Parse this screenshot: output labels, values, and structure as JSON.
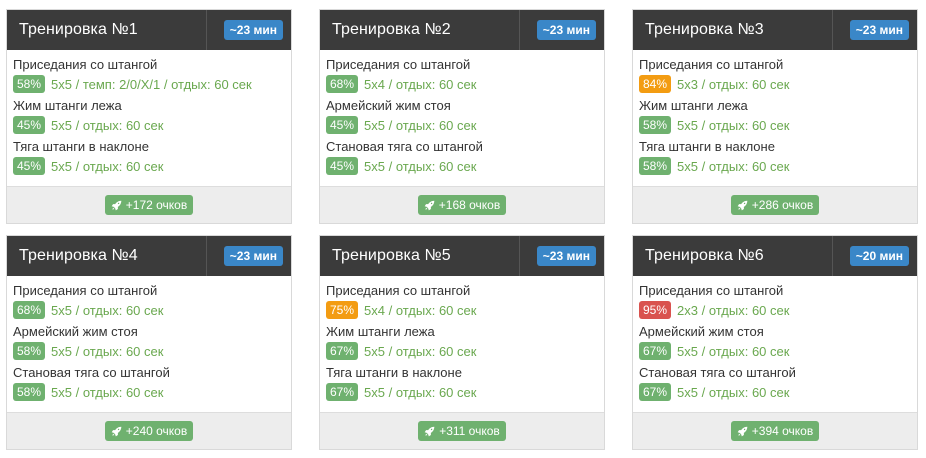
{
  "workouts": [
    {
      "title": "Тренировка №1",
      "duration": "~23 мин",
      "exercises": [
        {
          "name": "Приседания со штангой",
          "percent": "58%",
          "percent_color": "green",
          "detail": "5x5 / темп: 2/0/X/1 / отдых: 60 сек"
        },
        {
          "name": "Жим штанги лежа",
          "percent": "45%",
          "percent_color": "green",
          "detail": "5x5 / отдых: 60 сек"
        },
        {
          "name": "Тяга штанги в наклоне",
          "percent": "45%",
          "percent_color": "green",
          "detail": "5x5 / отдых: 60 сек"
        }
      ],
      "points": "+172 очков"
    },
    {
      "title": "Тренировка №2",
      "duration": "~23 мин",
      "exercises": [
        {
          "name": "Приседания со штангой",
          "percent": "68%",
          "percent_color": "green",
          "detail": "5x4 / отдых: 60 сек"
        },
        {
          "name": "Армейский жим стоя",
          "percent": "45%",
          "percent_color": "green",
          "detail": "5x5 / отдых: 60 сек"
        },
        {
          "name": "Становая тяга со штангой",
          "percent": "45%",
          "percent_color": "green",
          "detail": "5x5 / отдых: 60 сек"
        }
      ],
      "points": "+168 очков"
    },
    {
      "title": "Тренировка №3",
      "duration": "~23 мин",
      "exercises": [
        {
          "name": "Приседания со штангой",
          "percent": "84%",
          "percent_color": "orange",
          "detail": "5x3 / отдых: 60 сек"
        },
        {
          "name": "Жим штанги лежа",
          "percent": "58%",
          "percent_color": "green",
          "detail": "5x5 / отдых: 60 сек"
        },
        {
          "name": "Тяга штанги в наклоне",
          "percent": "58%",
          "percent_color": "green",
          "detail": "5x5 / отдых: 60 сек"
        }
      ],
      "points": "+286 очков"
    },
    {
      "title": "Тренировка №4",
      "duration": "~23 мин",
      "exercises": [
        {
          "name": "Приседания со штангой",
          "percent": "68%",
          "percent_color": "green",
          "detail": "5x5 / отдых: 60 сек"
        },
        {
          "name": "Армейский жим стоя",
          "percent": "58%",
          "percent_color": "green",
          "detail": "5x5 / отдых: 60 сек"
        },
        {
          "name": "Становая тяга со штангой",
          "percent": "58%",
          "percent_color": "green",
          "detail": "5x5 / отдых: 60 сек"
        }
      ],
      "points": "+240 очков"
    },
    {
      "title": "Тренировка №5",
      "duration": "~23 мин",
      "exercises": [
        {
          "name": "Приседания со штангой",
          "percent": "75%",
          "percent_color": "orange",
          "detail": "5x4 / отдых: 60 сек"
        },
        {
          "name": "Жим штанги лежа",
          "percent": "67%",
          "percent_color": "green",
          "detail": "5x5 / отдых: 60 сек"
        },
        {
          "name": "Тяга штанги в наклоне",
          "percent": "67%",
          "percent_color": "green",
          "detail": "5x5 / отдых: 60 сек"
        }
      ],
      "points": "+311 очков"
    },
    {
      "title": "Тренировка №6",
      "duration": "~20 мин",
      "exercises": [
        {
          "name": "Приседания со штангой",
          "percent": "95%",
          "percent_color": "red",
          "detail": "2x3 / отдых: 60 сек"
        },
        {
          "name": "Армейский жим стоя",
          "percent": "67%",
          "percent_color": "green",
          "detail": "5x5 / отдых: 60 сек"
        },
        {
          "name": "Становая тяга со штангой",
          "percent": "67%",
          "percent_color": "green",
          "detail": "5x5 / отдых: 60 сек"
        }
      ],
      "points": "+394 очков"
    }
  ],
  "icons": {
    "points": "rocket-icon"
  },
  "colors": {
    "header": "#3b3b3b",
    "duration_badge": "#3a87c8",
    "green": "#6fb16f",
    "orange": "#f39c12",
    "red": "#d9534f",
    "detail_text": "#6aa84f"
  }
}
